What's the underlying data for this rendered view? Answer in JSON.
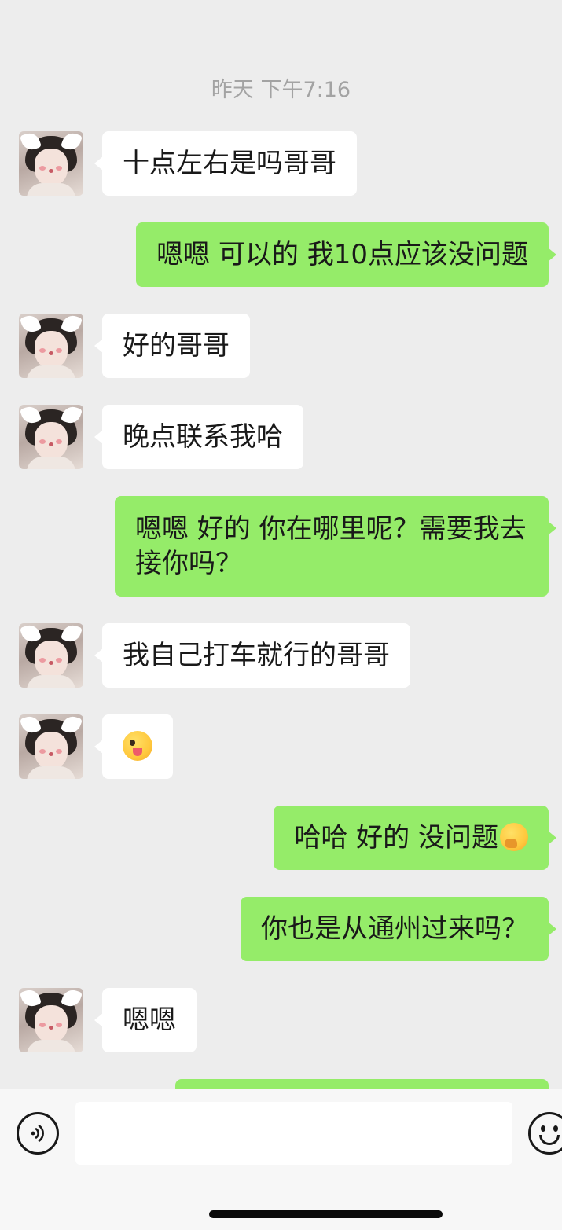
{
  "chat": {
    "timestamp": "昨天 下午7:16",
    "messages": [
      {
        "side": "left",
        "text": "十点左右是吗哥哥"
      },
      {
        "side": "right",
        "text": "嗯嗯 可以的 我10点应该没问题"
      },
      {
        "side": "left",
        "text": "好的哥哥"
      },
      {
        "side": "left",
        "text": "晚点联系我哈"
      },
      {
        "side": "right",
        "text_line1": "嗯嗯 好的 你在哪里呢？需要我去",
        "text_line2": "接你吗？"
      },
      {
        "side": "left",
        "text": "我自己打车就行的哥哥"
      },
      {
        "side": "left",
        "emoji": "wink-tongue-emoji"
      },
      {
        "side": "right",
        "text": "哈哈 好的 没问题",
        "emoji": "thinking-hand-emoji"
      },
      {
        "side": "right",
        "text": "你也是从通州过来吗？"
      },
      {
        "side": "left",
        "text": "嗯嗯"
      }
    ]
  },
  "input_bar": {
    "voice_icon": "voice-icon",
    "text_value": "",
    "emoji_icon": "smiley-icon"
  },
  "colors": {
    "background": "#ededed",
    "incoming_bubble": "#ffffff",
    "outgoing_bubble": "#95ec69",
    "timestamp_text": "#a3a3a3"
  }
}
